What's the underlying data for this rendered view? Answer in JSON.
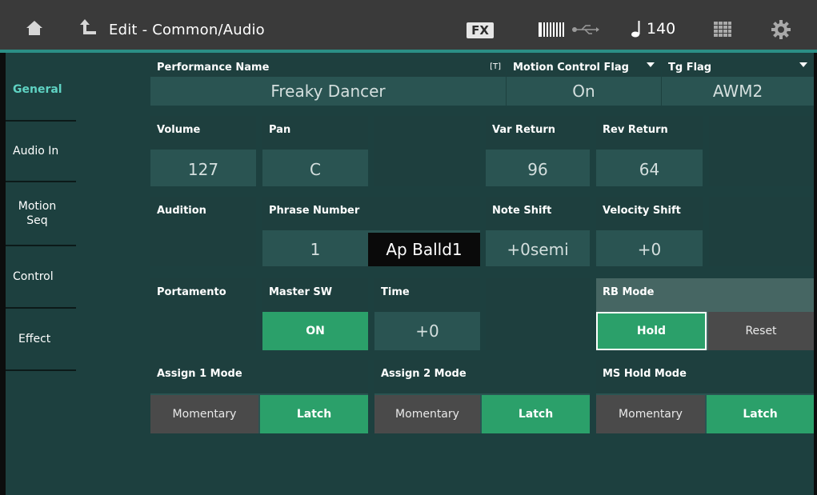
{
  "header": {
    "title": "Edit - Common/Audio",
    "fx_badge": "FX",
    "tempo": "140",
    "icons": [
      "home-icon",
      "back-icon",
      "keyboard-icon",
      "usb-icon",
      "note-icon",
      "grid-icon",
      "gear-icon"
    ]
  },
  "sidebar": {
    "tabs": [
      {
        "label": "General",
        "active": true
      },
      {
        "label": "Audio In",
        "active": false
      },
      {
        "label": "Motion Seq",
        "active": false
      },
      {
        "label": "Control",
        "active": false
      },
      {
        "label": "Effect",
        "active": false
      }
    ]
  },
  "performance": {
    "name_label": "Performance Name",
    "name_marker": "[T]",
    "name_value": "Freaky Dancer",
    "motion_label": "Motion Control Flag",
    "motion_value": "On",
    "tg_label": "Tg Flag",
    "tg_value": "AWM2"
  },
  "mix": {
    "volume_label": "Volume",
    "volume_value": "127",
    "pan_label": "Pan",
    "pan_value": "C",
    "var_return_label": "Var Return",
    "var_return_value": "96",
    "rev_return_label": "Rev Return",
    "rev_return_value": "64"
  },
  "audition": {
    "label": "Audition",
    "phrase_label": "Phrase Number",
    "phrase_number": "1",
    "phrase_name": "Ap Balld1",
    "note_shift_label": "Note Shift",
    "note_shift_value": "+0semi",
    "velocity_shift_label": "Velocity Shift",
    "velocity_shift_value": "+0"
  },
  "portamento": {
    "label": "Portamento",
    "master_sw_label": "Master SW",
    "master_sw_value": "ON",
    "time_label": "Time",
    "time_value": "+0",
    "rb_mode_label": "RB Mode",
    "rb_hold": "Hold",
    "rb_reset": "Reset"
  },
  "assign": {
    "assign1_label": "Assign 1 Mode",
    "assign2_label": "Assign 2 Mode",
    "ms_hold_label": "MS Hold Mode",
    "momentary": "Momentary",
    "latch": "Latch"
  },
  "colors": {
    "accent": "#5fd3c3",
    "on_green": "#2ba06a",
    "panel": "#1d403f",
    "topline": "#2b8f86"
  }
}
